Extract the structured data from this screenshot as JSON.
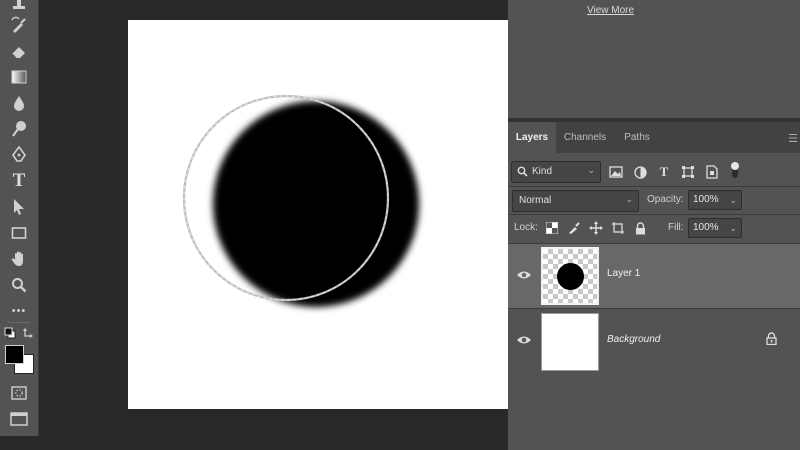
{
  "toolbar": {
    "tools": [
      {
        "icon": "stamp-icon"
      },
      {
        "icon": "history-brush-icon"
      },
      {
        "icon": "eraser-icon"
      },
      {
        "icon": "gradient-icon"
      },
      {
        "icon": "blur-drop-icon"
      },
      {
        "icon": "dodge-icon"
      },
      {
        "icon": "pen-icon"
      },
      {
        "icon": "type-icon",
        "glyph": "T"
      },
      {
        "icon": "path-selection-icon"
      },
      {
        "icon": "rectangle-icon"
      },
      {
        "icon": "hand-icon"
      },
      {
        "icon": "zoom-icon"
      },
      {
        "icon": "more-tools-icon",
        "glyph": "•••"
      }
    ],
    "foreground_color": "#000000",
    "background_color": "#ffffff"
  },
  "canvas": {
    "background": "#ffffff",
    "shape_fill": "#000000"
  },
  "learn_panel": {
    "view_more": "View More"
  },
  "layers_panel": {
    "tabs": [
      "Layers",
      "Channels",
      "Paths"
    ],
    "active_tab": "Layers",
    "filter": {
      "kind_label": "Kind"
    },
    "blend_mode": "Normal",
    "opacity_label": "Opacity:",
    "opacity_value": "100%",
    "lock_label": "Lock:",
    "fill_label": "Fill:",
    "fill_value": "100%",
    "layers": [
      {
        "name": "Layer 1",
        "visible": true,
        "selected": true
      },
      {
        "name": "Background",
        "visible": true,
        "locked": true
      }
    ]
  },
  "colors": {
    "panel_bg": "#535353",
    "app_bg": "#282828",
    "selected_row": "#686868"
  }
}
